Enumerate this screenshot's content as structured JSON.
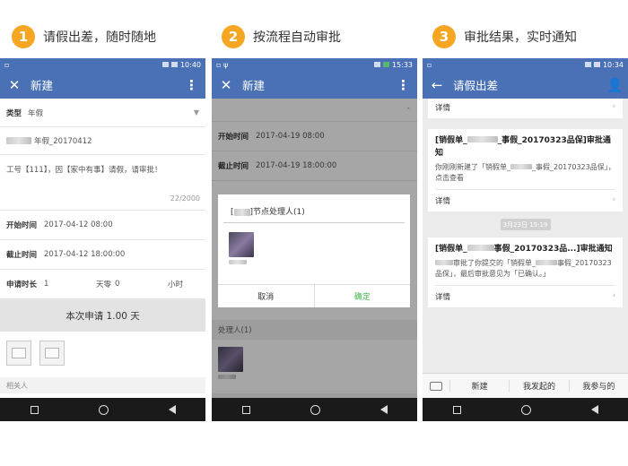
{
  "steps": [
    {
      "num": "1",
      "title": "请假出差，随时随地"
    },
    {
      "num": "2",
      "title": "按流程自动审批"
    },
    {
      "num": "3",
      "title": "审批结果，实时通知"
    }
  ],
  "phone1": {
    "time": "10:40",
    "title": "新建",
    "type_label": "类型",
    "type_value": "年假",
    "name_value": "年假_20170412",
    "reason_text": "工号【111】，因【家中有事】请假，请审批！",
    "char_count": "22/2000",
    "start_label": "开始时间",
    "start_value": "2017-04-12 08:00",
    "end_label": "截止时间",
    "end_value": "2017-04-12 18:00:00",
    "duration_label": "申请时长",
    "duration_value": "1",
    "rest_label": "天零",
    "rest_value": "0",
    "unit": "小时",
    "apply_button": "本次申请 1.00 天",
    "related_label": "相关人"
  },
  "phone2": {
    "time": "15:33",
    "title": "新建",
    "start_label": "开始时间",
    "start_value": "2017-04-19 08:00",
    "end_label": "截止时间",
    "end_value": "2017-04-19 18:00:00",
    "dialog_title": "]节点处理人(1)",
    "cancel": "取消",
    "confirm": "确定",
    "handler_label": "处理人(1)"
  },
  "phone3": {
    "time": "10:34",
    "title": "请假出差",
    "details": "详情",
    "card1_title_a": "[销假单_",
    "card1_title_b": "_事假_20170323品保]审批通知",
    "card1_body_a": "你刚刚新建了「销假单_",
    "card1_body_b": "_事假_20170323品保」，点击查看",
    "time_pill": "3月23日  15:19",
    "card2_title_a": "[销假单_",
    "card2_title_b": "事假_20170323品...]审批通知",
    "card2_body_a": "",
    "card2_body_b": "审批了你提交的「销假单_",
    "card2_body_c": "事假_20170323品保」，最后审批意见为「已确认。」",
    "menu_new": "新建",
    "menu_mine": "我发起的",
    "menu_joined": "我参与的"
  },
  "colors": {
    "accent": "#4a71b5",
    "step_badge": "#f5a623",
    "confirm_green": "#3bb44a"
  }
}
